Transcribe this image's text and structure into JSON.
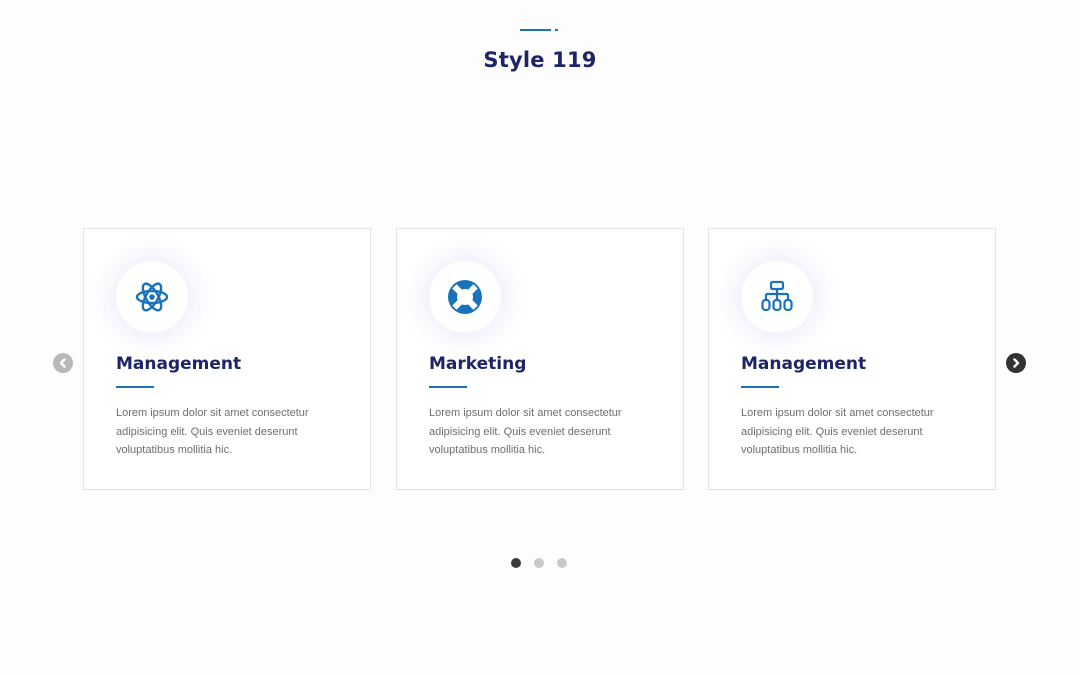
{
  "heading": {
    "title": "Style 119"
  },
  "colors": {
    "accent": "#1a73b8",
    "title": "#1d2566",
    "text": "#6e6e73"
  },
  "cards": [
    {
      "icon": "atom-icon",
      "title": "Management",
      "text": "Lorem ipsum dolor sit amet consectetur adipisicing elit. Quis eveniet deserunt voluptatibus mollitia hic."
    },
    {
      "icon": "lifebuoy-icon",
      "title": "Marketing",
      "text": "Lorem ipsum dolor sit amet consectetur adipisicing elit. Quis eveniet deserunt voluptatibus mollitia hic."
    },
    {
      "icon": "sitemap-icon",
      "title": "Management",
      "text": "Lorem ipsum dolor sit amet consectetur adipisicing elit. Quis eveniet deserunt voluptatibus mollitia hic."
    }
  ],
  "carousel": {
    "prev_icon": "chevron-left-icon",
    "next_icon": "chevron-right-icon",
    "page_count": 3,
    "active_page": 1
  }
}
